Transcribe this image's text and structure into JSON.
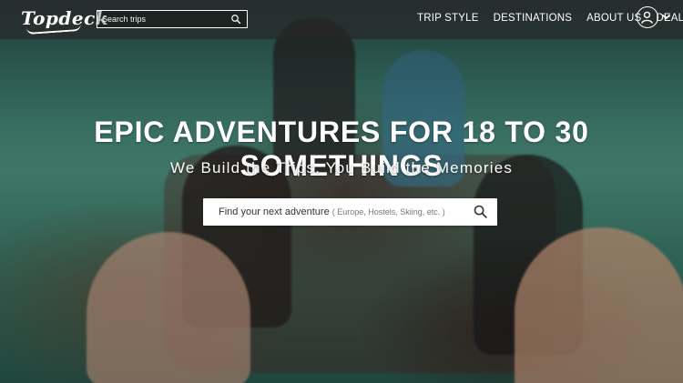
{
  "header": {
    "logo_text": "Topdeck",
    "search_placeholder": "Search trips",
    "nav": [
      "TRIP STYLE",
      "DESTINATIONS",
      "ABOUT US",
      "DEALS"
    ]
  },
  "hero": {
    "title": "EPIC ADVENTURES FOR 18 TO 30 SOMETHINGS",
    "subtitle": "We Build the Trips. You Build the Memories",
    "search_main": "Find your next adventure",
    "search_hint": "( Europe, Hostels, Skiing, etc. )"
  },
  "colors": {
    "header_bg": "#282828",
    "text": "#ffffff"
  },
  "icons": {
    "search": "search-icon",
    "account": "user-icon",
    "dropdown": "chevron-down-icon"
  }
}
